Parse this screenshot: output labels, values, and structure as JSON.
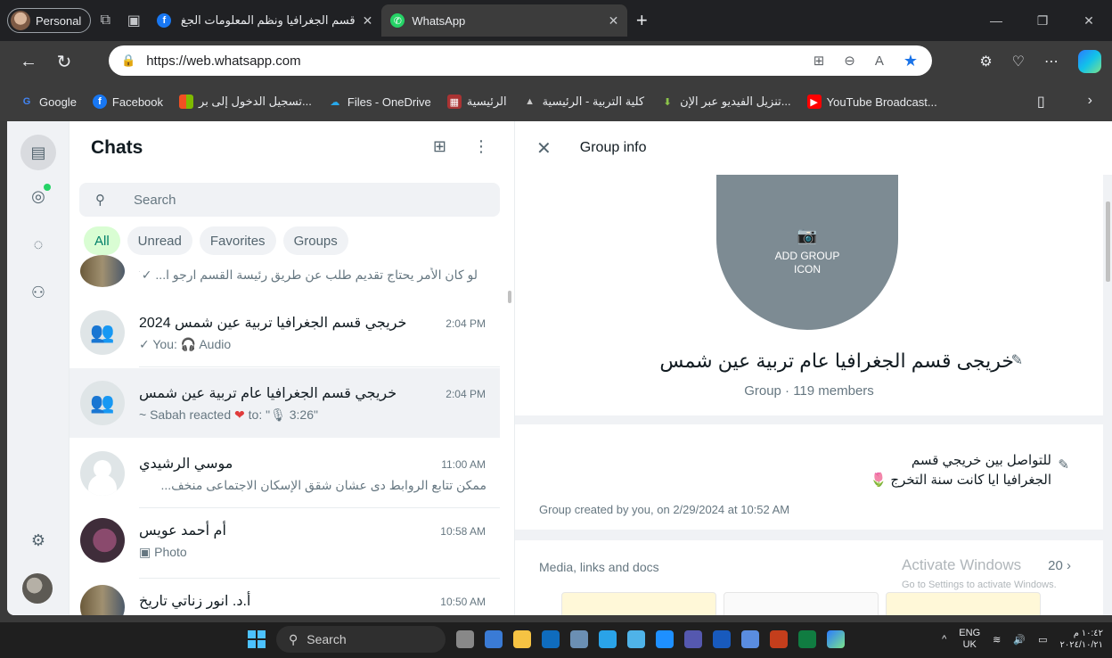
{
  "browser": {
    "profile_label": "Personal",
    "tabs": [
      {
        "title": "قسم الجغرافيا ونظم المعلومات الجغ",
        "favicon": "facebook-icon"
      },
      {
        "title": "WhatsApp",
        "favicon": "whatsapp-icon"
      }
    ],
    "url": "https://web.whatsapp.com",
    "bookmarks": [
      "Google",
      "Facebook",
      "تسجيل الدخول إلى بر...",
      "Files - OneDrive",
      "الرئيسية",
      "كلية التربية - الرئيسية",
      "تنزيل الفيديو عبر الإن...",
      "YouTube Broadcast..."
    ]
  },
  "chat_list": {
    "title": "Chats",
    "search_placeholder": "Search",
    "filters": [
      "All",
      "Unread",
      "Favorites",
      "Groups"
    ],
    "chats": [
      {
        "name": "",
        "time": "",
        "preview": "لو كان الأمر يحتاج تقديم طلب عن طريق رئيسة القسم ارجو ا... ✓✓"
      },
      {
        "name": "خريجي قسم الجغرافيا تربية عين شمس 2024",
        "time": "2:04 PM",
        "preview": "✓ You: 🎧 Audio"
      },
      {
        "name": "خريجي قسم الجغرافيا عام تربية عين شمس",
        "time": "2:04 PM",
        "preview_prefix": "~ Sabah reacted",
        "preview_suffix": "to: \"🎙 3:26\""
      },
      {
        "name": "موسي الرشيدي",
        "time": "11:00 AM",
        "preview": "ممكن تتابع الروابط دى عشان شقق الإسكان الاجتماعى منخف..."
      },
      {
        "name": "أم أحمد عويس",
        "time": "10:58 AM",
        "preview": "Photo"
      },
      {
        "name": "أ.د. انور زناتي تاريخ",
        "time": "10:50 AM",
        "preview": ""
      }
    ]
  },
  "group_info": {
    "header_title": "Group info",
    "add_icon_label_1": "ADD GROUP",
    "add_icon_label_2": "ICON",
    "group_name": "خريجى قسم الجغرافيا عام تربية عين شمس",
    "group_subtitle": "Group · 119 members",
    "description_line1": "للتواصل بين خريجي قسم",
    "description_line2": "الجغرافيا ايا كانت سنة التخرج 🌷",
    "created_text": "Group created by you, on 2/29/2024 at 10:52 AM",
    "media_label": "Media, links and docs",
    "media_count": "20 ›",
    "activate_title": "Activate Windows",
    "activate_sub": "Go to Settings to activate Windows."
  },
  "taskbar": {
    "search_label": "Search",
    "lang_top": "ENG",
    "lang_bottom": "UK",
    "time": "١٠:٤٢ م",
    "date": "٢٠٢٤/١٠/٢١"
  }
}
